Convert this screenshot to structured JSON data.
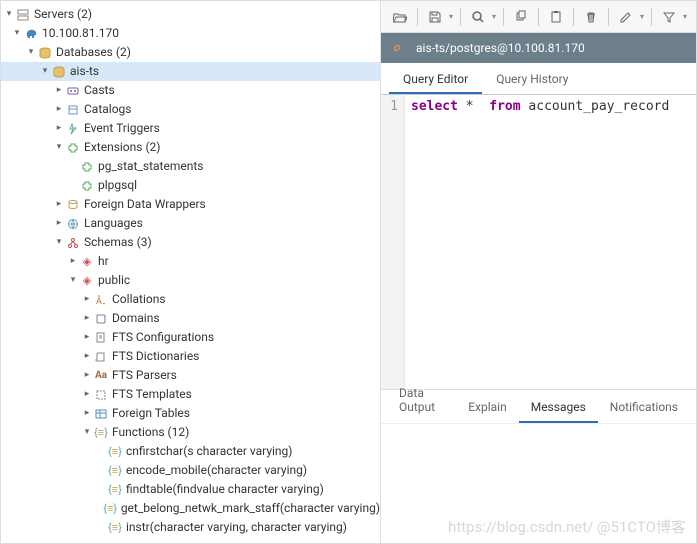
{
  "tree": {
    "root": "Servers (2)",
    "server": "10.100.81.170",
    "databases": "Databases (2)",
    "db": "ais-ts",
    "casts": "Casts",
    "catalogs": "Catalogs",
    "event_triggers": "Event Triggers",
    "extensions": "Extensions (2)",
    "ext1": "pg_stat_statements",
    "ext2": "plpgsql",
    "fdw": "Foreign Data Wrappers",
    "languages": "Languages",
    "schemas": "Schemas (3)",
    "schema_hr": "hr",
    "schema_public": "public",
    "collations": "Collations",
    "domains": "Domains",
    "fts_conf": "FTS Configurations",
    "fts_dict": "FTS Dictionaries",
    "fts_parsers": "FTS Parsers",
    "fts_templates": "FTS Templates",
    "foreign_tables": "Foreign Tables",
    "functions": "Functions (12)",
    "fn1": "cnfirstchar(s character varying)",
    "fn2": "encode_mobile(character varying)",
    "fn3": "findtable(findvalue character varying)",
    "fn4": "get_belong_netwk_mark_staff(character varying)",
    "fn5": "instr(character varying, character varying)"
  },
  "conn": {
    "label": "ais-ts/postgres@10.100.81.170"
  },
  "editor_tabs": {
    "t1": "Query Editor",
    "t2": "Query History"
  },
  "output_tabs": {
    "t1": "Data Output",
    "t2": "Explain",
    "t3": "Messages",
    "t4": "Notifications"
  },
  "code": {
    "line1_no": "1",
    "kw_select": "select",
    "star": " * ",
    "kw_from": " from ",
    "tbl": "account_pay_record"
  },
  "chart_data": {
    "type": "table",
    "note": "SQL query editor view; single line of SQL text, no tabular result rendered"
  },
  "watermark": "https://blog.csdn.net/ @51CTO博客"
}
